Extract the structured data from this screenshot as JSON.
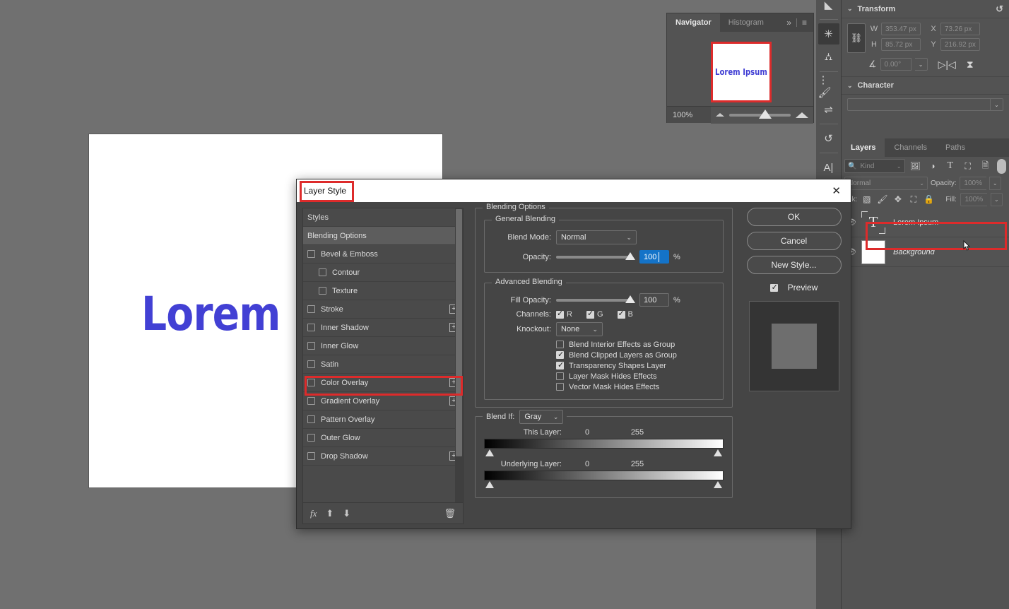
{
  "canvas": {
    "text": "Lorem Ipsum",
    "text_color": "#4240d4"
  },
  "navigator": {
    "tabs": [
      {
        "label": "Navigator",
        "active": true
      },
      {
        "label": "Histogram",
        "active": false
      }
    ],
    "expand_icon": "chevron-double-right-icon",
    "menu_icon": "panel-menu-icon",
    "thumbnail_text": "Lorem Ipsum",
    "thumbnail_border_color": "#dd2b2b",
    "zoom_level": "100%"
  },
  "rail": {
    "icons": [
      "brush-preset-icon",
      "snowflake-icon",
      "brush-settings-icon",
      "brush-list-icon",
      "adjustments-icon",
      "history-icon",
      "character-icon",
      "paragraph-icon"
    ]
  },
  "transform": {
    "title": "Transform",
    "reset_icon": "reset-icon",
    "link_icon": "link-icon",
    "w_label": "W",
    "w_value": "353.47 px",
    "h_label": "H",
    "h_value": "85.72 px",
    "x_label": "X",
    "x_value": "73.26 px",
    "y_label": "Y",
    "y_value": "216.92 px",
    "angle_icon": "angle-icon",
    "angle_value": "0.00°",
    "flip_h_icon": "flip-horizontal-icon",
    "flip_v_icon": "flip-vertical-icon"
  },
  "character": {
    "title": "Character",
    "font_value": ""
  },
  "layers_panel": {
    "tabs": [
      {
        "label": "Layers",
        "active": true
      },
      {
        "label": "Channels",
        "active": false
      },
      {
        "label": "Paths",
        "active": false
      }
    ],
    "filter": {
      "search_icon": "search-icon",
      "kind_label": "Kind",
      "icons": [
        "image-filter-icon",
        "adjustment-filter-icon",
        "type-filter-icon",
        "shape-filter-icon",
        "smart-object-filter-icon"
      ],
      "toggle_icon": "filter-toggle-icon"
    },
    "blend_mode": "Normal",
    "opacity_label": "Opacity:",
    "opacity_value": "100%",
    "lock_label": "ock:",
    "lock_icons": [
      "lock-transparency-icon",
      "lock-image-icon",
      "lock-position-icon",
      "lock-artboard-icon",
      "lock-all-icon"
    ],
    "fill_label": "Fill:",
    "fill_value": "100%",
    "layers": [
      {
        "name": "Lorem Ipsum",
        "type": "text",
        "visible": true,
        "selected": true,
        "italic": false
      },
      {
        "name": "Background",
        "type": "image",
        "visible": true,
        "selected": false,
        "italic": true
      }
    ],
    "highlight_color": "#dd2b2b"
  },
  "dialog": {
    "title": "Layer Style",
    "title_highlight_color": "#dd2b2b",
    "close_icon": "close-icon",
    "styles": [
      {
        "label": "Styles",
        "checkbox": false,
        "checked": false,
        "plus": false,
        "selected": false,
        "indent": false
      },
      {
        "label": "Blending Options",
        "checkbox": false,
        "checked": false,
        "plus": false,
        "selected": true,
        "indent": false
      },
      {
        "label": "Bevel & Emboss",
        "checkbox": true,
        "checked": false,
        "plus": false,
        "selected": false,
        "indent": false
      },
      {
        "label": "Contour",
        "checkbox": true,
        "checked": false,
        "plus": false,
        "selected": false,
        "indent": true
      },
      {
        "label": "Texture",
        "checkbox": true,
        "checked": false,
        "plus": false,
        "selected": false,
        "indent": true
      },
      {
        "label": "Stroke",
        "checkbox": true,
        "checked": false,
        "plus": true,
        "selected": false,
        "indent": false
      },
      {
        "label": "Inner Shadow",
        "checkbox": true,
        "checked": false,
        "plus": true,
        "selected": false,
        "indent": false
      },
      {
        "label": "Inner Glow",
        "checkbox": true,
        "checked": false,
        "plus": false,
        "selected": false,
        "indent": false
      },
      {
        "label": "Satin",
        "checkbox": true,
        "checked": false,
        "plus": false,
        "selected": false,
        "indent": false
      },
      {
        "label": "Color Overlay",
        "checkbox": true,
        "checked": false,
        "plus": true,
        "selected": false,
        "indent": false,
        "highlighted": true
      },
      {
        "label": "Gradient Overlay",
        "checkbox": true,
        "checked": false,
        "plus": true,
        "selected": false,
        "indent": false
      },
      {
        "label": "Pattern Overlay",
        "checkbox": true,
        "checked": false,
        "plus": false,
        "selected": false,
        "indent": false
      },
      {
        "label": "Outer Glow",
        "checkbox": true,
        "checked": false,
        "plus": false,
        "selected": false,
        "indent": false
      },
      {
        "label": "Drop Shadow",
        "checkbox": true,
        "checked": false,
        "plus": true,
        "selected": false,
        "indent": false
      }
    ],
    "styles_footer": {
      "fx_icon": "fx-icon",
      "up_icon": "move-up-icon",
      "down_icon": "move-down-icon",
      "trash_icon": "trash-icon"
    },
    "blending_options": {
      "group_label": "Blending Options",
      "general": {
        "group_label": "General Blending",
        "blend_mode_label": "Blend Mode:",
        "blend_mode_value": "Normal",
        "opacity_label": "Opacity:",
        "opacity_value": "100",
        "opacity_unit": "%",
        "opacity_focused": true
      },
      "advanced": {
        "group_label": "Advanced Blending",
        "fill_opacity_label": "Fill Opacity:",
        "fill_opacity_value": "100",
        "fill_opacity_unit": "%",
        "channels_label": "Channels:",
        "channels": [
          {
            "label": "R",
            "checked": true
          },
          {
            "label": "G",
            "checked": true
          },
          {
            "label": "B",
            "checked": true
          }
        ],
        "knockout_label": "Knockout:",
        "knockout_value": "None",
        "checkboxes": [
          {
            "label": "Blend Interior Effects as Group",
            "checked": false
          },
          {
            "label": "Blend Clipped Layers as Group",
            "checked": true
          },
          {
            "label": "Transparency Shapes Layer",
            "checked": true
          },
          {
            "label": "Layer Mask Hides Effects",
            "checked": false
          },
          {
            "label": "Vector Mask Hides Effects",
            "checked": false
          }
        ]
      },
      "blend_if": {
        "label": "Blend If:",
        "channel_value": "Gray",
        "this_layer_label": "This Layer:",
        "this_layer_min": "0",
        "this_layer_max": "255",
        "underlying_label": "Underlying Layer:",
        "underlying_min": "0",
        "underlying_max": "255"
      }
    },
    "buttons": {
      "ok": "OK",
      "cancel": "Cancel",
      "new_style": "New Style...",
      "preview_label": "Preview",
      "preview_checked": true
    }
  }
}
